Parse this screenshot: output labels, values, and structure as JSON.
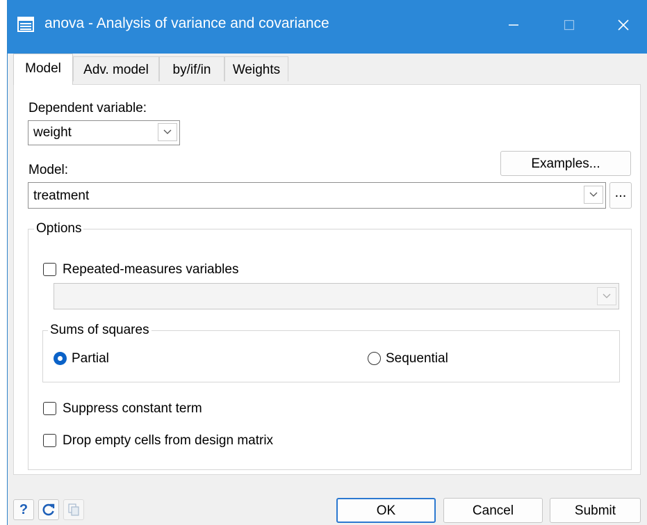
{
  "window": {
    "title": "anova - Analysis of variance and covariance",
    "controls": {
      "minimize": "—",
      "maximize": "☐",
      "close": "✕"
    },
    "titlebar_color": "#2b88d8"
  },
  "tabs": [
    {
      "label": "Model",
      "active": true
    },
    {
      "label": "Adv. model",
      "active": false
    },
    {
      "label": "by/if/in",
      "active": false
    },
    {
      "label": "Weights",
      "active": false
    }
  ],
  "model_tab": {
    "dependent_variable_label": "Dependent variable:",
    "dependent_variable_value": "weight",
    "model_label": "Model:",
    "examples_button": "Examples...",
    "model_value": "treatment",
    "model_browse_button": "...",
    "options": {
      "legend": "Options",
      "repeated_measures_label": "Repeated-measures variables",
      "repeated_measures_checked": false,
      "repeated_measures_value": "",
      "sums_of_squares": {
        "legend": "Sums of squares",
        "partial_label": "Partial",
        "sequential_label": "Sequential",
        "selected": "Partial"
      },
      "suppress_constant_label": "Suppress constant term",
      "suppress_constant_checked": false,
      "drop_empty_cells_label": "Drop empty cells from design matrix",
      "drop_empty_cells_checked": false
    }
  },
  "footer": {
    "help_icon": "?",
    "reset_icon": "reset-icon",
    "copy_icon": "copy-icon",
    "ok_label": "OK",
    "cancel_label": "Cancel",
    "submit_label": "Submit"
  },
  "colors": {
    "accent": "#2b88d8",
    "radio_selected": "#0a62c8",
    "default_button_border": "#2b78d0"
  }
}
